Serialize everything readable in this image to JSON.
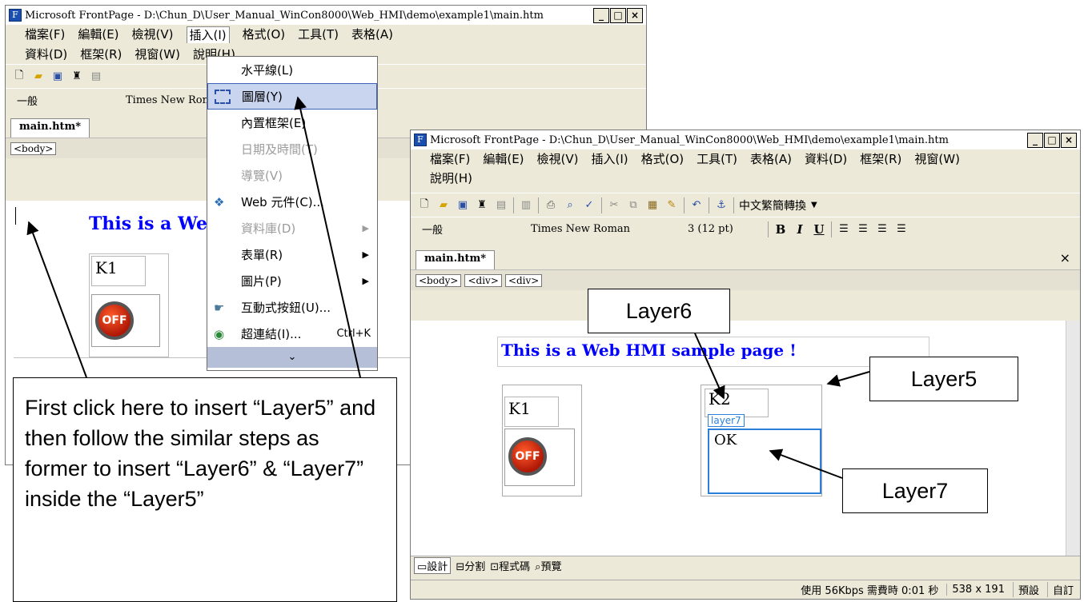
{
  "window_left": {
    "title": "Microsoft FrontPage - D:\\Chun_D\\User_Manual_WinCon8000\\Web_HMI\\demo\\example1\\main.htm",
    "menus": [
      "檔案(F)",
      "編輯(E)",
      "檢視(V)",
      "插入(I)",
      "格式(O)",
      "工具(T)",
      "表格(A)",
      "資料(D)",
      "框架(R)",
      "視窗(W)",
      "說明(H)"
    ],
    "style_combo": "一般",
    "font_combo": "Times New Roman",
    "tab": "main.htm*",
    "crumb": "<body>",
    "banner": "This is a Web HMI sample page !",
    "k1": "K1",
    "off": "OFF"
  },
  "insert_menu": {
    "items": [
      {
        "label": "水平線(L)",
        "state": "normal"
      },
      {
        "label": "圖層(Y)",
        "state": "highlighted"
      },
      {
        "label": "內置框架(E)",
        "state": "normal"
      },
      {
        "label": "日期及時間(T)",
        "state": "disabled"
      },
      {
        "label": "導覽(V)",
        "state": "disabled"
      },
      {
        "label": "Web 元件(C)...",
        "state": "normal"
      },
      {
        "label": "資料庫(D)",
        "state": "disabled",
        "submenu": true
      },
      {
        "label": "表單(R)",
        "state": "normal",
        "submenu": true
      },
      {
        "label": "圖片(P)",
        "state": "normal",
        "submenu": true
      },
      {
        "label": "互動式按鈕(U)...",
        "state": "normal"
      },
      {
        "label": "超連結(I)...",
        "state": "normal",
        "shortcut": "Ctrl+K"
      }
    ],
    "more": "¥"
  },
  "window_right": {
    "title": "Microsoft FrontPage - D:\\Chun_D\\User_Manual_WinCon8000\\Web_HMI\\demo\\example1\\main.htm",
    "menus": [
      "檔案(F)",
      "編輯(E)",
      "檢視(V)",
      "插入(I)",
      "格式(O)",
      "工具(T)",
      "表格(A)",
      "資料(D)",
      "框架(R)",
      "視窗(W)",
      "說明(H)"
    ],
    "toolbar_convert": "中文繁簡轉換",
    "style_combo": "一般",
    "font_combo": "Times New Roman",
    "size_combo": "3 (12 pt)",
    "format_buttons": [
      "B",
      "I",
      "U"
    ],
    "tab": "main.htm*",
    "crumbs": [
      "<body>",
      "<div>",
      "<div>"
    ],
    "banner": "This is a Web HMI sample page !",
    "k1": "K1",
    "k2": "K2",
    "off": "OFF",
    "layer7_tag": "layer7",
    "ok": "OK",
    "view_tabs": [
      "設計",
      "分割",
      "程式碼",
      "預覽"
    ],
    "status": {
      "download": "使用 56Kbps 需費時 0:01 秒",
      "dims": "538 x 191",
      "mode1": "預設",
      "mode2": "自訂"
    }
  },
  "callouts": {
    "main": "First click here to insert “Layer5” and then follow the similar steps as former to insert “Layer6” & “Layer7” inside the “Layer5”",
    "layer5": "Layer5",
    "layer6": "Layer6",
    "layer7": "Layer7"
  },
  "colors": {
    "banner_text": "#0000ff",
    "menu_highlight": "#c9d4ef",
    "layer7_border": "#2b7fd9"
  }
}
